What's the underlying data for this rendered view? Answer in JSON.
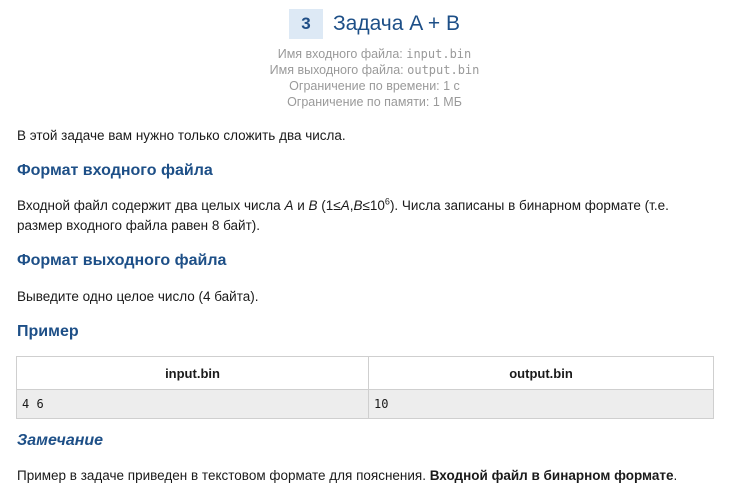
{
  "problem": {
    "number": "3",
    "title": "Задача A + B"
  },
  "limits": {
    "input_label": "Имя входного файла: ",
    "input_value": "input.bin",
    "output_label": "Имя выходного файла: ",
    "output_value": "output.bin",
    "time": "Ограничение по времени: 1 с",
    "memory": "Ограничение по памяти: 1 МБ"
  },
  "statement": "В этой задаче вам нужно только сложить два числа.",
  "input_section": {
    "heading": "Формат входного файла",
    "line1_before": "Входной файл содержит два целых числа ",
    "var_a": "A",
    "and": " и ",
    "var_b": "B",
    "cond_open": " (1≤",
    "cond_mid": ",",
    "cond_le": "≤10",
    "cond_exp": "6",
    "line1_after": "). Числа записаны в бинарном формате (т.е.",
    "line2": "размер входного файла равен 8 байт)."
  },
  "output_section": {
    "heading": "Формат выходного файла",
    "text": "Выведите одно целое число (4 байта)."
  },
  "example": {
    "heading": "Пример",
    "columns": [
      "input.bin",
      "output.bin"
    ],
    "rows": [
      [
        "4 6",
        "10"
      ]
    ]
  },
  "note": {
    "heading": "Замечание",
    "text": "Пример в задаче приведен в текстовом формате для пояснения. ",
    "bold": "Входной файл в бинарном формате",
    "end": "."
  }
}
